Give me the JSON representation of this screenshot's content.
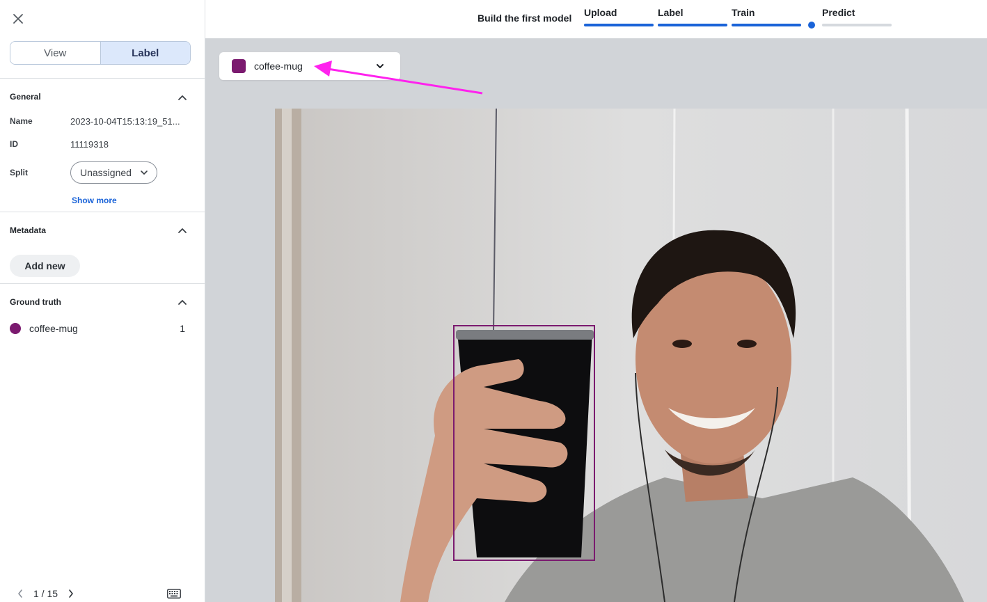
{
  "sidebar": {
    "mode_toggle": {
      "view_label": "View",
      "label_label": "Label",
      "active": "Label"
    },
    "general": {
      "title": "General",
      "name_label": "Name",
      "name_value": "2023-10-04T15:13:19_51...",
      "id_label": "ID",
      "id_value": "11119318",
      "split_label": "Split",
      "split_value": "Unassigned",
      "show_more": "Show more"
    },
    "metadata": {
      "title": "Metadata",
      "add_new": "Add new"
    },
    "ground_truth": {
      "title": "Ground truth",
      "items": [
        {
          "name": "coffee-mug",
          "count": "1",
          "color": "#7b1a6f"
        }
      ]
    },
    "pager": {
      "text": "1 / 15"
    }
  },
  "topbar": {
    "title": "Build the first model",
    "steps": [
      {
        "label": "Upload",
        "status": "done"
      },
      {
        "label": "Label",
        "status": "done"
      },
      {
        "label": "Train",
        "status": "done"
      },
      {
        "label": "Predict",
        "status": "pending"
      }
    ],
    "accent": "#1a63d8"
  },
  "canvas": {
    "class_select": {
      "value": "coffee-mug",
      "color": "#7b1a6f"
    },
    "annotation_color": "#ff22ee"
  },
  "icons": {
    "close": "close-icon",
    "chevron_up": "chevron-up-icon",
    "chevron_down": "chevron-down-icon",
    "keyboard": "keyboard-icon",
    "prev": "chevron-left-icon",
    "next": "chevron-right-icon"
  }
}
